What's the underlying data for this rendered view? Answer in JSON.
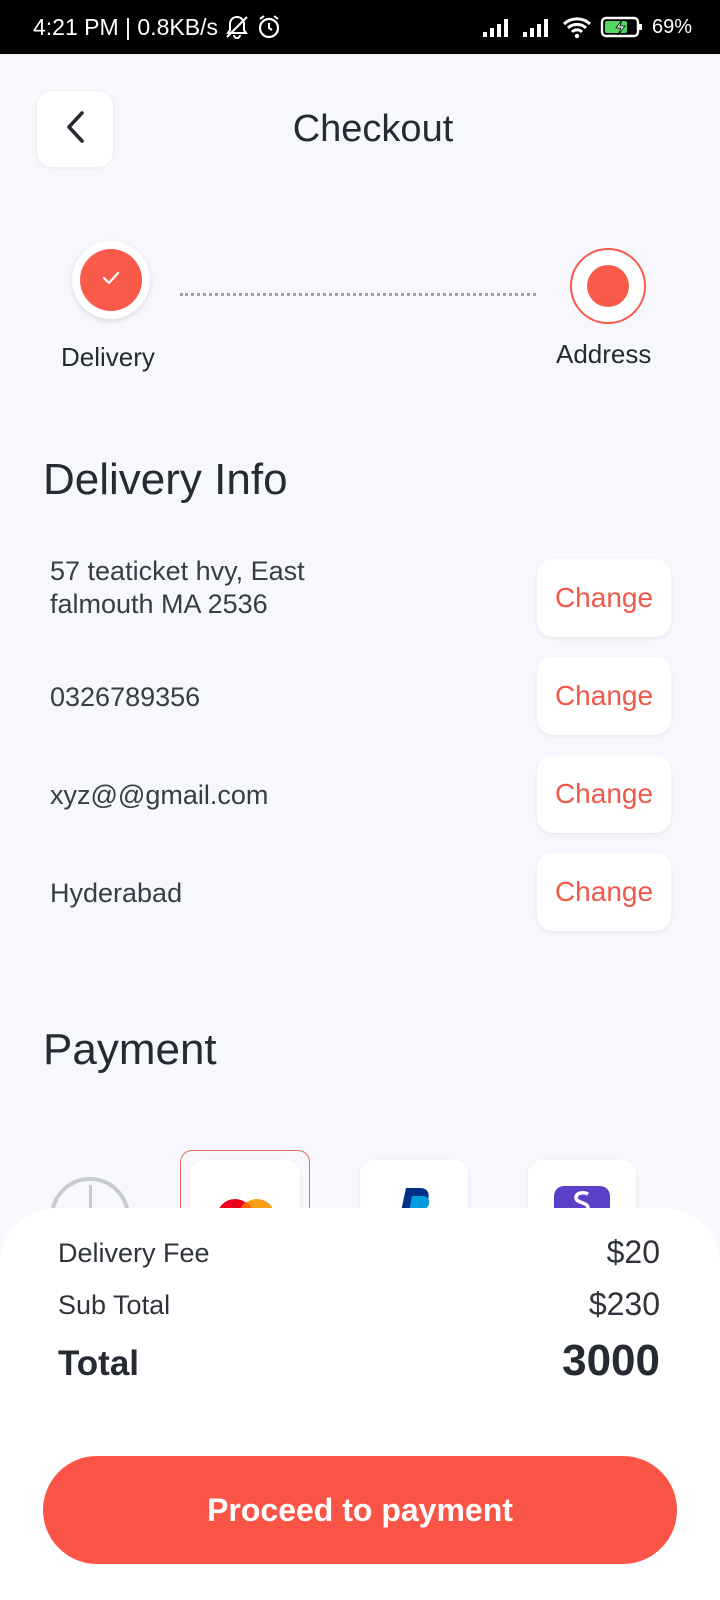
{
  "status_bar": {
    "time_speed": "4:21 PM | 0.8KB/s",
    "battery": "69%",
    "icons": [
      "mute-bell-icon",
      "alarm-icon",
      "signal-icon",
      "signal-icon",
      "wifi-icon",
      "battery-charging-icon"
    ]
  },
  "header": {
    "title": "Checkout",
    "back_icon": "chevron-left-icon"
  },
  "stepper": {
    "steps": [
      {
        "label": "Delivery",
        "state": "done"
      },
      {
        "label": "Address",
        "state": "current"
      }
    ]
  },
  "delivery_info": {
    "title": "Delivery Info",
    "rows": [
      {
        "lines": [
          "57 teaticket hvy, East",
          "falmouth MA 2536"
        ],
        "action": "Change"
      },
      {
        "lines": [
          "0326789356"
        ],
        "action": "Change"
      },
      {
        "lines": [
          "xyz@@gmail.com"
        ],
        "action": "Change"
      },
      {
        "lines": [
          "Hyderabad"
        ],
        "action": "Change"
      }
    ]
  },
  "payment": {
    "title": "Payment",
    "methods": [
      "add-card-icon",
      "mastercard-icon",
      "paypal-icon",
      "skrill-icon"
    ],
    "selected": "mastercard-icon"
  },
  "summary": {
    "delivery_fee_label": "Delivery Fee",
    "delivery_fee_value": "$20",
    "sub_total_label": "Sub Total",
    "sub_total_value": "$230",
    "total_label": "Total",
    "total_value": "3000"
  },
  "cta": {
    "label": "Proceed to payment"
  },
  "colors": {
    "accent": "#fa5446",
    "background": "#f6f8fd"
  }
}
